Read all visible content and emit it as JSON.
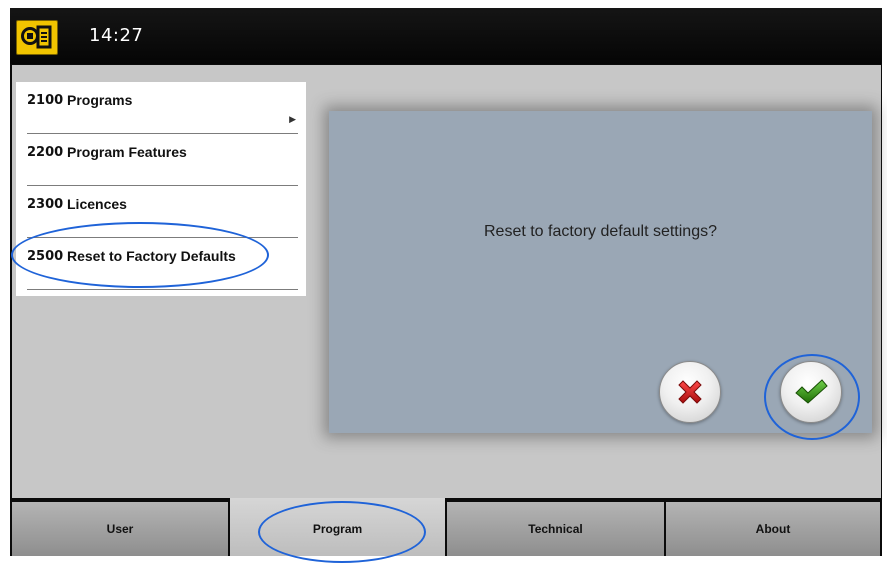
{
  "header": {
    "time": "14:27",
    "app_icon": "panoramic-unit-icon"
  },
  "menu": {
    "items": [
      {
        "code": "2100",
        "label": "Programs",
        "has_submenu": true
      },
      {
        "code": "2200",
        "label": "Program Features"
      },
      {
        "code": "2300",
        "label": "Licences"
      },
      {
        "code": "2500",
        "label": "Reset to Factory Defaults",
        "highlighted": true
      }
    ]
  },
  "dialog": {
    "message": "Reset to factory default settings?",
    "cancel_icon": "red-x-icon",
    "confirm_icon": "green-check-icon"
  },
  "tabs": [
    {
      "label": "User"
    },
    {
      "label": "Program",
      "active": true
    },
    {
      "label": "Technical"
    },
    {
      "label": "About"
    }
  ],
  "colors": {
    "dialog_bg": "#9aa7b5",
    "highlight": "#1f63d8",
    "app_icon_bg": "#f1c400",
    "cancel": "#d42020",
    "confirm": "#2e8b0e"
  }
}
